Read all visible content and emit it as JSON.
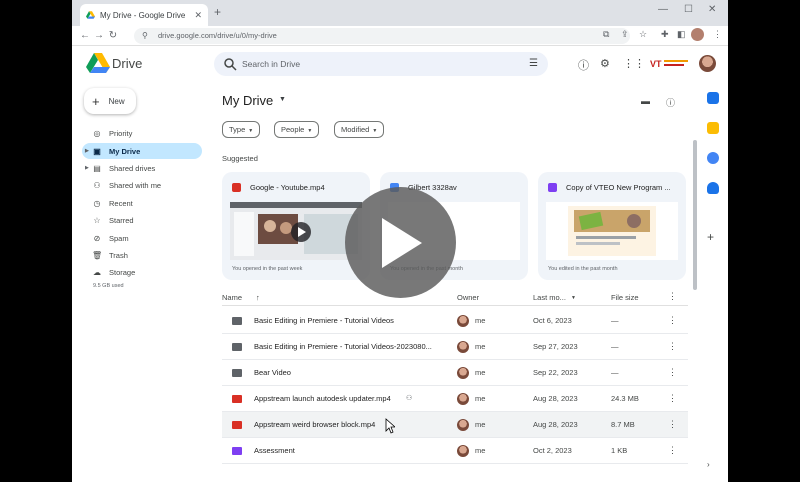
{
  "browser": {
    "tab_title": "My Drive - Google Drive",
    "url": "drive.google.com/drive/u/0/my-drive"
  },
  "app": {
    "name": "Drive",
    "search_placeholder": "Search in Drive",
    "new_label": "New"
  },
  "sidebar": {
    "items": [
      {
        "label": "Priority",
        "icon": "check-circle-icon"
      },
      {
        "label": "My Drive",
        "icon": "drive-folder-icon",
        "active": true
      },
      {
        "label": "Shared drives",
        "icon": "shared-drive-icon"
      },
      {
        "label": "Shared with me",
        "icon": "people-icon"
      },
      {
        "label": "Recent",
        "icon": "clock-icon"
      },
      {
        "label": "Starred",
        "icon": "star-icon"
      },
      {
        "label": "Spam",
        "icon": "spam-icon"
      },
      {
        "label": "Trash",
        "icon": "trash-icon"
      },
      {
        "label": "Storage",
        "icon": "cloud-icon"
      }
    ],
    "storage_used": "9.5 GB used"
  },
  "main": {
    "title": "My Drive",
    "filters": [
      "Type",
      "People",
      "Modified"
    ],
    "suggested_label": "Suggested",
    "cards": [
      {
        "title": "Google - Youtube.mp4",
        "subtitle": "You opened in the past week",
        "icon_color": "#d93025"
      },
      {
        "title": "Gilbert 3328av",
        "subtitle": "You opened in the past month",
        "icon_color": "#4285f4"
      },
      {
        "title": "Copy of VTEO New Program ...",
        "subtitle": "You edited in the past month",
        "icon_color": "#7e3ff2"
      }
    ],
    "columns": {
      "name": "Name",
      "owner": "Owner",
      "modified": "Last mo...",
      "size": "File size"
    },
    "files": [
      {
        "name": "Basic Editing in Premiere - Tutorial Videos",
        "type": "shared-folder",
        "owner": "me",
        "modified": "Oct 6, 2023",
        "size": "—"
      },
      {
        "name": "Basic Editing in Premiere - Tutorial Videos-2023080...",
        "type": "shared-folder",
        "owner": "me",
        "modified": "Sep 27, 2023",
        "size": "—"
      },
      {
        "name": "Bear Video",
        "type": "folder",
        "owner": "me",
        "modified": "Sep 22, 2023",
        "size": "—"
      },
      {
        "name": "Appstream launch autodesk updater.mp4",
        "type": "video",
        "owner": "me",
        "modified": "Aug 28, 2023",
        "size": "24.3 MB",
        "shared": true
      },
      {
        "name": "Appstream weird browser block.mp4",
        "type": "video",
        "owner": "me",
        "modified": "Aug 28, 2023",
        "size": "8.7 MB"
      },
      {
        "name": "Assessment",
        "type": "form",
        "owner": "me",
        "modified": "Oct 2, 2023",
        "size": "1 KB"
      }
    ]
  },
  "colors": {
    "accent": "#c2e7ff",
    "video": "#d93025",
    "form": "#7e3ff2",
    "folder": "#5f6368"
  }
}
